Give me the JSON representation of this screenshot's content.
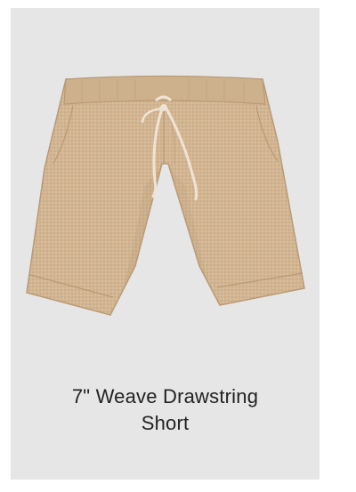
{
  "product": {
    "title_line1": "7\" Weave Drawstring",
    "title_line2": "Short",
    "image_icon": "shorts-image",
    "colors": {
      "card_background": "#e6e6e7",
      "fabric": "#d2b592",
      "fabric_shadow": "#b99a76",
      "drawstring": "#efe3d4",
      "title_text": "#222222"
    }
  }
}
